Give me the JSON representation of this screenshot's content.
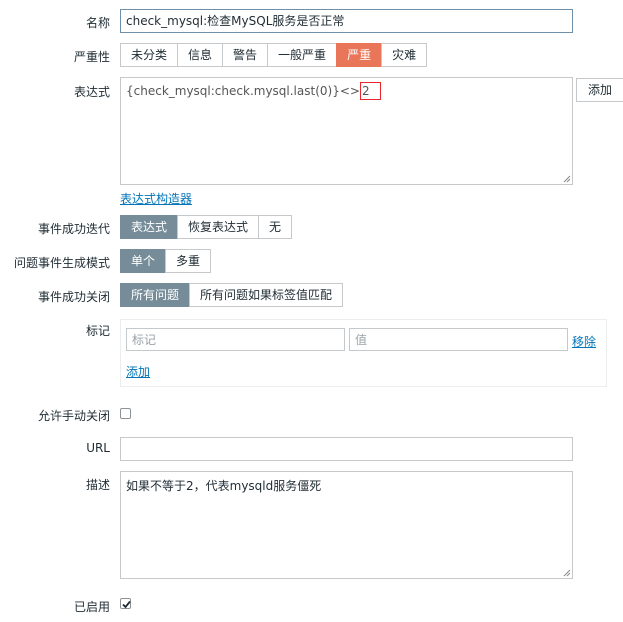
{
  "form": {
    "name": {
      "label": "名称",
      "value": "check_mysql:检查MySQL服务是否正常"
    },
    "severity": {
      "label": "严重性",
      "options": [
        "未分类",
        "信息",
        "警告",
        "一般严重",
        "严重",
        "灾难"
      ],
      "selected": "严重"
    },
    "expression": {
      "label": "表达式",
      "value_prefix": "{check_mysql:check.mysql.last(0)}<>",
      "value_highlight": "2",
      "add_button": "添加",
      "constructor_link": "表达式构造器"
    },
    "ok_event": {
      "label": "事件成功迭代",
      "options": [
        "表达式",
        "恢复表达式",
        "无"
      ],
      "selected": "表达式"
    },
    "problem_mode": {
      "label": "问题事件生成模式",
      "options": [
        "单个",
        "多重"
      ],
      "selected": "单个"
    },
    "ok_close": {
      "label": "事件成功关闭",
      "options": [
        "所有问题",
        "所有问题如果标签值匹配"
      ],
      "selected": "所有问题"
    },
    "tags": {
      "label": "标记",
      "tag_placeholder": "标记",
      "value_placeholder": "值",
      "remove_link": "移除",
      "add_link": "添加"
    },
    "manual_close": {
      "label": "允许手动关闭",
      "checked": false
    },
    "url": {
      "label": "URL",
      "value": ""
    },
    "description": {
      "label": "描述",
      "value": "如果不等于2，代表mysqld服务僵死"
    },
    "enabled": {
      "label": "已启用",
      "checked": true
    }
  },
  "colors": {
    "selected_gray": "#768d99",
    "selected_red": "#e97659",
    "link": "#0275b8",
    "highlight_box": "#e8262b"
  }
}
